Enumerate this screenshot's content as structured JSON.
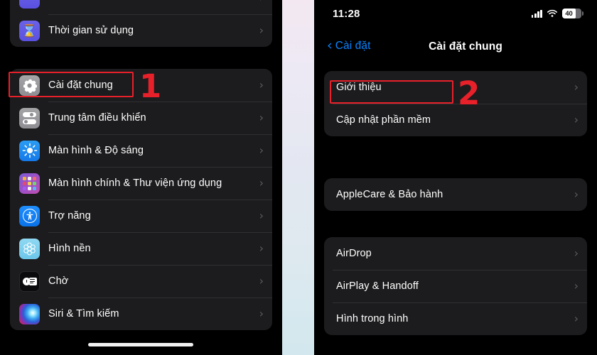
{
  "left_screen": {
    "name": "ios-settings-list",
    "groups": [
      {
        "name": "group-screentime",
        "items": [
          {
            "label": "",
            "icon": "partial-icon",
            "icon_kind": "partial"
          },
          {
            "label": "Thời gian sử dụng",
            "icon": "hourglass-icon",
            "icon_kind": "hourglass"
          }
        ]
      },
      {
        "name": "group-general",
        "items": [
          {
            "label": "Cài đặt chung",
            "icon": "gear-icon",
            "icon_kind": "gear"
          },
          {
            "label": "Trung tâm điều khiển",
            "icon": "control-center-icon",
            "icon_kind": "controlcenter"
          },
          {
            "label": "Màn hình & Độ sáng",
            "icon": "brightness-icon",
            "icon_kind": "brightness"
          },
          {
            "label": "Màn hình chính & Thư viện ứng dụng",
            "icon": "home-screen-icon",
            "icon_kind": "homescreen"
          },
          {
            "label": "Trợ năng",
            "icon": "accessibility-icon",
            "icon_kind": "accessibility"
          },
          {
            "label": "Hình nền",
            "icon": "wallpaper-icon",
            "icon_kind": "wallpaper"
          },
          {
            "label": "Chờ",
            "icon": "standby-icon",
            "icon_kind": "standby"
          },
          {
            "label": "Siri & Tìm kiếm",
            "icon": "siri-icon",
            "icon_kind": "siri"
          }
        ]
      }
    ],
    "chevron": "›"
  },
  "right_screen": {
    "name": "ios-general-settings",
    "status_bar": {
      "time": "11:28",
      "signal_icon": "cellular-signal-icon",
      "wifi_icon": "wifi-icon",
      "battery_icon": "battery-icon",
      "battery_percent": "40"
    },
    "nav": {
      "back_label": "Cài đặt",
      "back_caret": "‹",
      "title": "Cài đặt chung"
    },
    "groups": [
      {
        "name": "group-about",
        "items": [
          {
            "label": "Giới thiệu"
          },
          {
            "label": "Cập nhật phần mềm"
          }
        ]
      },
      {
        "name": "group-applecare",
        "items": [
          {
            "label": "AppleCare & Bảo hành"
          }
        ]
      },
      {
        "name": "group-sharing",
        "items": [
          {
            "label": "AirDrop"
          },
          {
            "label": "AirPlay & Handoff"
          },
          {
            "label": "Hình trong hình"
          }
        ]
      }
    ],
    "chevron": "›"
  },
  "annotations": {
    "step_one": "1",
    "step_two": "2",
    "color": "#e8202a"
  },
  "colors": {
    "background": "#000000",
    "card": "#1c1c1e",
    "separator": "#303032",
    "text_primary": "#ffffff",
    "accent_blue": "#0a84ff",
    "chevron": "#5b5b5f",
    "annotation_red": "#e8202a"
  }
}
